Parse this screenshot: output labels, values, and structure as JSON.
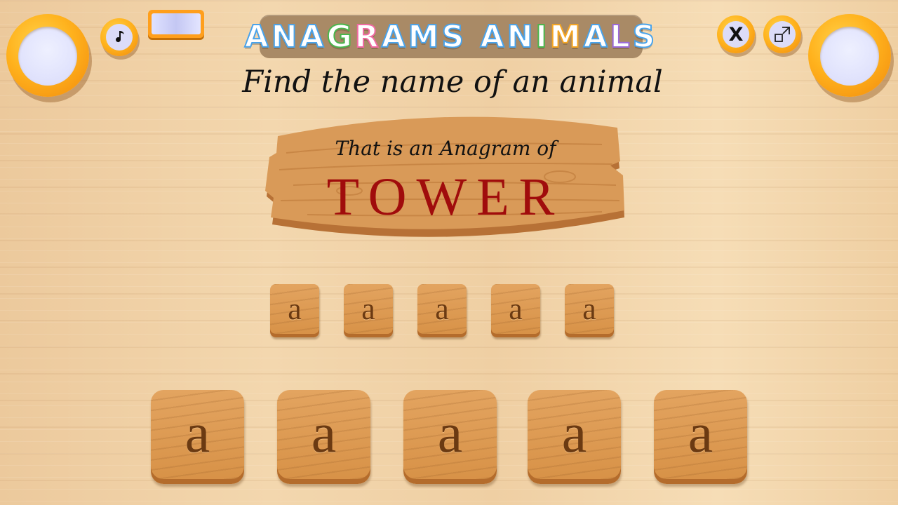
{
  "header": {
    "title_letters": [
      {
        "ch": "A",
        "c": "c-blue"
      },
      {
        "ch": "N",
        "c": "c-blue"
      },
      {
        "ch": "A",
        "c": "c-blue"
      },
      {
        "ch": "G",
        "c": "c-green"
      },
      {
        "ch": "R",
        "c": "c-pink"
      },
      {
        "ch": "A",
        "c": "c-blue"
      },
      {
        "ch": "M",
        "c": "c-blue"
      },
      {
        "ch": "S",
        "c": "c-blue"
      },
      {
        "ch": " ",
        "c": ""
      },
      {
        "ch": "A",
        "c": "c-blue"
      },
      {
        "ch": "N",
        "c": "c-blue"
      },
      {
        "ch": "I",
        "c": "c-green"
      },
      {
        "ch": "M",
        "c": "c-orange"
      },
      {
        "ch": "A",
        "c": "c-blue"
      },
      {
        "ch": "L",
        "c": "c-purple"
      },
      {
        "ch": "S",
        "c": "c-blue"
      }
    ],
    "title": "ANAGRAMS ANIMALS"
  },
  "controls": {
    "music_icon": "music-note-icon",
    "tv_icon": "tv-icon",
    "close_label": "X",
    "fullscreen_icon": "fullscreen-icon"
  },
  "puzzle": {
    "instruction": "Find the name of an animal",
    "sign_label": "That is an Anagram of",
    "word": "TOWER"
  },
  "answer_slots": [
    "a",
    "a",
    "a",
    "a",
    "a"
  ],
  "letter_tiles": [
    "a",
    "a",
    "a",
    "a",
    "a"
  ],
  "colors": {
    "accent_orange": "#ffb21d",
    "word_red": "#a00c0c",
    "wood": "#d79146"
  }
}
